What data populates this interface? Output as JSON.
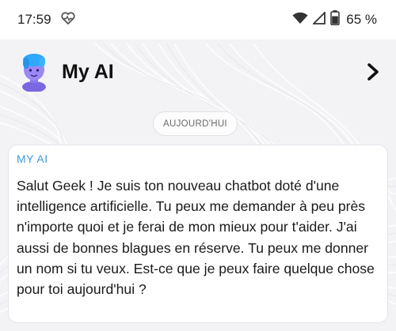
{
  "status_bar": {
    "time": "17:59",
    "battery": "65 %"
  },
  "header": {
    "title": "My AI"
  },
  "chat": {
    "date_divider": "AUJOURD'HUI",
    "messages": [
      {
        "sender": "MY AI",
        "text": "Salut Geek ! Je suis ton nouveau chatbot doté d'une intelligence artificielle. Tu peux me demander à peu près n'importe quoi et je ferai de mon mieux pour t'aider. J'ai aussi de bonnes blagues en réserve. Tu peux me donner un nom si tu veux. Est-ce que je peux faire quelque chose pour toi aujourd'hui ?"
      }
    ]
  },
  "colors": {
    "sender_accent": "#3e9bd8",
    "avatar_skin": "#8f7cf0",
    "avatar_hair": "#2ea7ff"
  },
  "icons": [
    "heart-pulse-icon",
    "wifi-icon",
    "signal-icon",
    "battery-icon",
    "chevron-right-icon"
  ]
}
